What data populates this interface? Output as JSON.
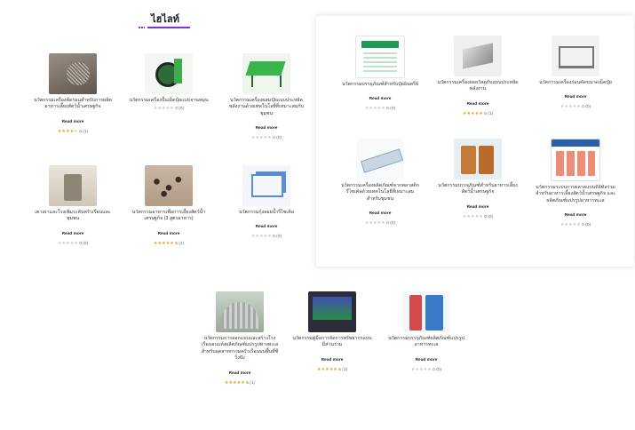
{
  "heading": "ไฮไลท์",
  "read_more_label": "Read more",
  "colors": {
    "accent": "#8a2be2",
    "star_on": "#e6a10a",
    "star_off": "#c8c8c8"
  },
  "products": [
    {
      "icon": "rotary-sieve-photo",
      "title": "นวัตกรรมเครื่องคัดร่อนสำหรับการผลิตอาหารเลี้ยงสัตว์น้ำเศรษฐกิจ",
      "stars": 4,
      "rating_text": "4 (1)"
    },
    {
      "icon": "drum-machine-photo",
      "title": "นวัตกรรมเครื่องปั้นเม็ดปุ๋ยแบบจานหมุน",
      "stars": 0,
      "rating_text": "0 (0)"
    },
    {
      "icon": "mixer-machine-photo",
      "title": "นวัตกรรมเครื่องผสมปุ๋ยแบบประหยัดพลังงานด้วยเทคโนโลยีที่เหมาะสมกับชุมชน",
      "stars": 0,
      "rating_text": "0 (0)"
    },
    {
      "icon": "lab-equipment-photo",
      "title": "เตาเผาและโรงเพิ่มระดับครัวเรือนและชุมชน",
      "stars": 0,
      "rating_text": "0 (0)"
    },
    {
      "icon": "feed-pellets-photo",
      "title": "นวัตกรรมอาหารเพื่อการเลี้ยงสัตว์น้ำเศรษฐกิจ (3 สูตรอาหาร)",
      "stars": 5,
      "rating_text": "5 (2)"
    },
    {
      "icon": "cage-model-photo",
      "title": "นวัตกรรมกุ้งลอยน้ำรีไซเคิล",
      "stars": 0,
      "rating_text": "0 (0)"
    },
    {
      "icon": "brochure-photo",
      "title": "นวัตกรรมบรรจุภัณฑ์สำหรับปุ๋ยอินทรีย์",
      "stars": 0,
      "rating_text": "0 (0)"
    },
    {
      "icon": "steel-machine-photo",
      "title": "นวัตกรรมเครื่องย่อยวัสดุกับแบบประหยัดพลังงาน",
      "stars": 5,
      "rating_text": "5 (1)"
    },
    {
      "icon": "steel-frame-photo",
      "title": "นวัตกรรมเครื่องร่อนคัดขนาดเม็ดปุ๋ย",
      "stars": 0,
      "rating_text": "0 (0)"
    },
    {
      "icon": "plastic-sheet-photo",
      "title": "นวัตกรรมเครื่องผลิตภัณฑ์จากพลาสติกรีไซเคิลด้วยเทคโนโลยีที่เหมาะสมสำหรับชุมชน",
      "stars": 0,
      "rating_text": "0 (0)"
    },
    {
      "icon": "feed-bags-photo",
      "title": "นวัตกรรมบรรจุภัณฑ์สำหรับอาหารเลี้ยงสัตว์น้ำเศรษฐกิจ",
      "stars": 0,
      "rating_text": "0 (0)"
    },
    {
      "icon": "website-screenshot",
      "title": "นวัตกรรมระบบการตลาดแบบดิจิทัลร่วมสำหรับอาหารเลี้ยงสัตว์น้ำเศรษฐกิจ และผลิตภัณฑ์แปรรูปอาหารทะเล",
      "stars": 0,
      "rating_text": "0 (0)"
    },
    {
      "icon": "greenhouse-tunnel-photo",
      "title": "นวัตกรรมการออกแบบและสร้างโรงเรือนอบแห้งผลิตภัณฑ์แปรรูปทางทะเลสำหรับอุตสาหกรรมครัวเรือนบนพื้นที่ชีวิ่งปัง",
      "stars": 5,
      "rating_text": "5 (1)"
    },
    {
      "icon": "monitor-screenshot",
      "title": "นวัตกรรมคู่มือการจัดการทรัพยากรแบบมีส่วนร่วม",
      "stars": 5,
      "rating_text": "5 (1)"
    },
    {
      "icon": "product-packaging-photo",
      "title": "นวัตกรรมบรรจุภัณฑ์ผลิตภัณฑ์แปรรูปอาหารทะเล",
      "stars": 0,
      "rating_text": "0 (0)"
    }
  ]
}
